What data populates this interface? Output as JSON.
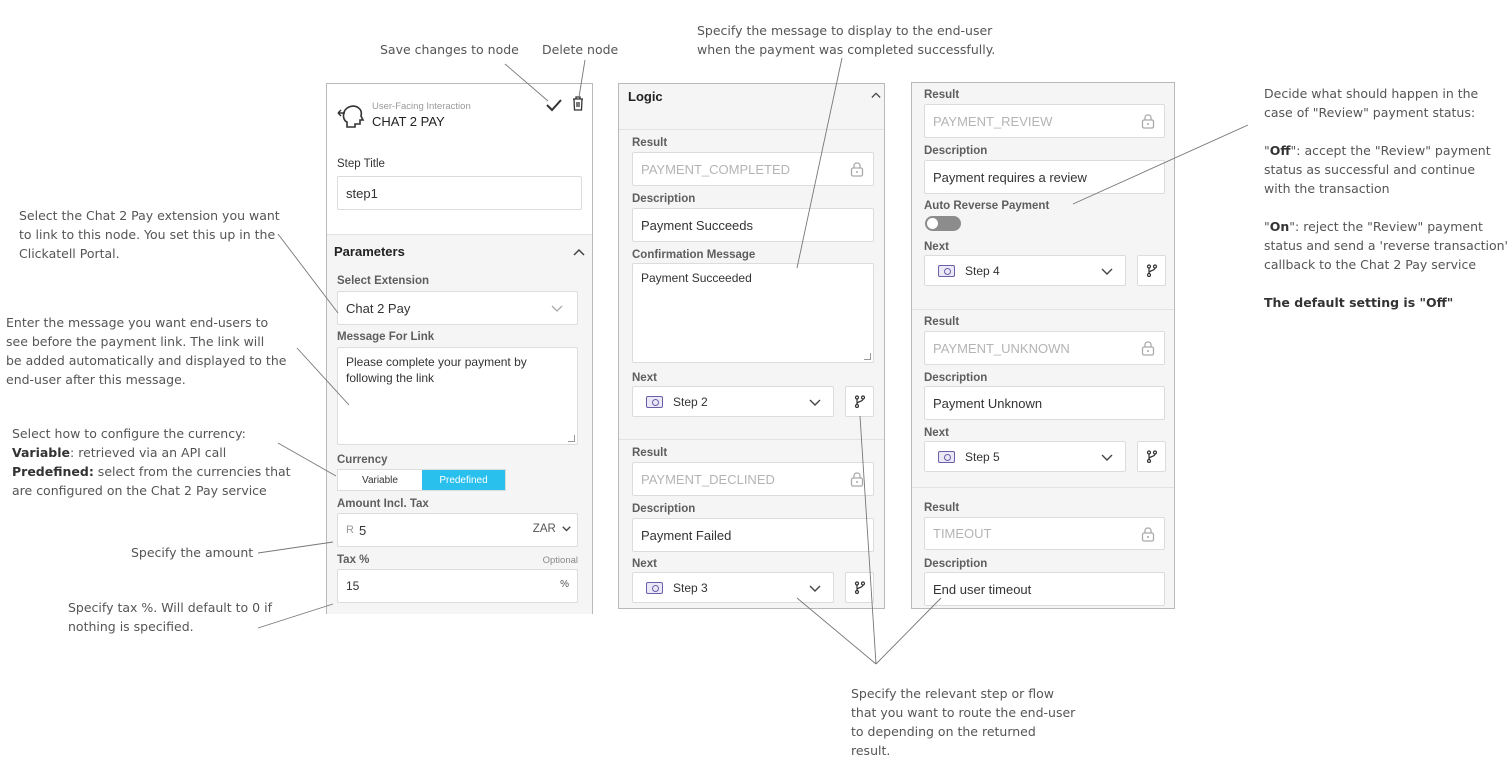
{
  "annotations": {
    "save": "Save changes to node",
    "delete": "Delete node",
    "confirmation": [
      "Specify the message to display to the end-user",
      "when the payment was completed successfully."
    ],
    "extension": [
      "Select the Chat 2 Pay extension you want",
      "to link to this node. You set this up in the",
      "Clickatell Portal."
    ],
    "message": [
      "Enter the message you want end-users to",
      "see before the payment link. The link will",
      "be added automatically and displayed to the",
      "end-user after this message."
    ],
    "currency": {
      "line1": "Select how to configure the currency:",
      "variable_bold": "Variable",
      "variable_rest": ": retrieved via an API call",
      "predefined_bold": "Predefined:",
      "predefined_rest": " select from the currencies that",
      "line4": "are configured on the Chat 2 Pay service"
    },
    "amount": "Specify the amount",
    "tax": [
      "Specify tax %. Will default to 0 if",
      "nothing is specified."
    ],
    "review": {
      "intro": [
        "Decide what should happen in the",
        "case of \"Review\" payment status:"
      ],
      "off_q1": "\"",
      "off_bold": "Off",
      "off_q2": "\": accept the \"Review\" payment",
      "off_2": "status as successful and continue",
      "off_3": "with the transaction",
      "on_q1": "\"",
      "on_bold": "On",
      "on_q2": "\": reject the \"Review\" payment",
      "on_2": "status and send a 'reverse transaction'",
      "on_3": "callback to the Chat 2 Pay service",
      "default": "The default setting is \"Off\""
    },
    "route": [
      "Specify the relevant step or flow",
      "that you want to route the end-user",
      "to depending on the returned",
      "result."
    ]
  },
  "node": {
    "category": "User-Facing Interaction",
    "title": "CHAT 2 PAY",
    "step_title_label": "Step Title",
    "step_title_value": "step1",
    "parameters_heading": "Parameters",
    "extension_label": "Select Extension",
    "extension_value": "Chat 2 Pay",
    "message_label": "Message For Link",
    "message_value": "Please complete your payment by following the link",
    "currency_label": "Currency",
    "currency_options": [
      "Variable",
      "Predefined"
    ],
    "currency_selected": "Predefined",
    "amount_label": "Amount Incl. Tax",
    "amount_prefix": "R",
    "amount_value": "5",
    "amount_currency": "ZAR",
    "tax_label": "Tax %",
    "tax_optional": "Optional",
    "tax_value": "15",
    "tax_unit": "%"
  },
  "logic": {
    "heading": "Logic",
    "results": [
      {
        "result_label": "Result",
        "result": "PAYMENT_COMPLETED",
        "description_label": "Description",
        "description": "Payment Succeeds",
        "confirmation_label": "Confirmation Message",
        "confirmation": "Payment Succeeded",
        "next_label": "Next",
        "next": "Step 2"
      },
      {
        "result_label": "Result",
        "result": "PAYMENT_DECLINED",
        "description_label": "Description",
        "description": "Payment Failed",
        "next_label": "Next",
        "next": "Step 3"
      }
    ]
  },
  "logic2": {
    "results": [
      {
        "result_label": "Result",
        "result": "PAYMENT_REVIEW",
        "description_label": "Description",
        "description": "Payment requires a review",
        "toggle_label": "Auto Reverse Payment",
        "toggle_on": false,
        "next_label": "Next",
        "next": "Step 4"
      },
      {
        "result_label": "Result",
        "result": "PAYMENT_UNKNOWN",
        "description_label": "Description",
        "description": "Payment Unknown",
        "next_label": "Next",
        "next": "Step 5"
      },
      {
        "result_label": "Result",
        "result": "TIMEOUT",
        "description_label": "Description",
        "description": "End user timeout"
      }
    ]
  },
  "colors": {
    "accent": "#29c0ee",
    "purple": "#6b5fa8",
    "border": "#b9b9b9"
  }
}
